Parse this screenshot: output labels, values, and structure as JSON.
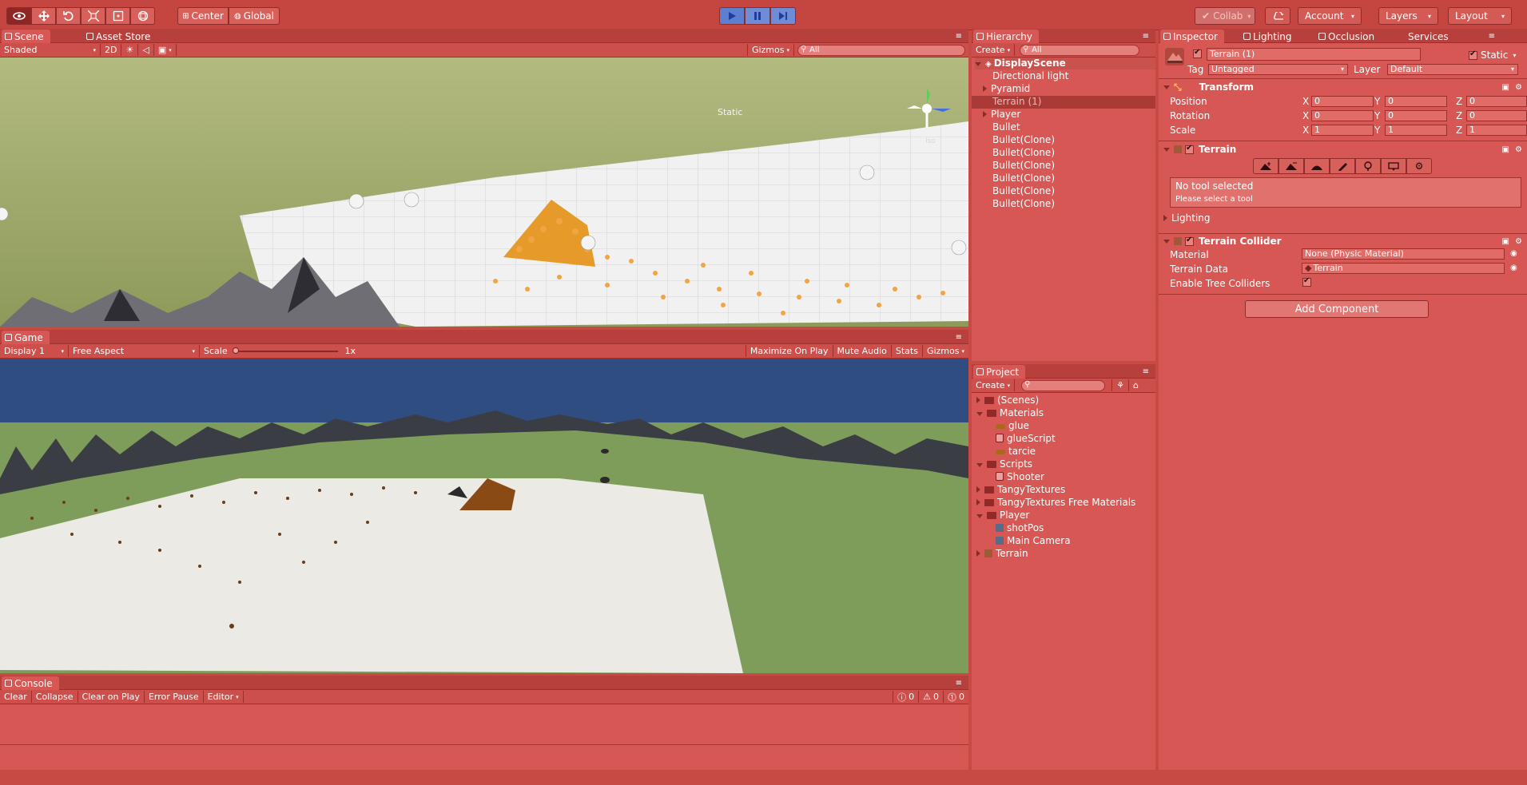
{
  "toolbar": {
    "pivot_label": "Center",
    "space_label": "Global",
    "collab_label": "Collab",
    "account_label": "Account",
    "layers_label": "Layers",
    "layout_label": "Layout",
    "tool_icons": [
      "eye-icon",
      "move-icon",
      "rotate-icon",
      "scale-icon",
      "rect-icon",
      "transform-icon"
    ]
  },
  "scene": {
    "tab_label": "Scene",
    "asset_store_label": "Asset Store",
    "shading_label": "Shaded",
    "mode_2d": "2D",
    "gizmos_label": "Gizmos",
    "search_placeholder": "All",
    "overlay_static": "Static",
    "overlay_iso": "Iso"
  },
  "game": {
    "tab_label": "Game",
    "display_label": "Display 1",
    "aspect_label": "Free Aspect",
    "scale_label": "Scale",
    "scale_value": "1x",
    "maximize_label": "Maximize On Play",
    "mute_label": "Mute Audio",
    "stats_label": "Stats",
    "gizmos_label": "Gizmos"
  },
  "console": {
    "tab_label": "Console",
    "buttons": [
      "Clear",
      "Collapse",
      "Clear on Play",
      "Error Pause",
      "Editor"
    ],
    "counts": {
      "info": "0",
      "warn": "0",
      "error": "0"
    }
  },
  "hierarchy": {
    "tab_label": "Hierarchy",
    "create_label": "Create",
    "search_placeholder": "All",
    "scene_name": "DisplayScene",
    "items": [
      {
        "label": "Directional light",
        "expandable": false,
        "selected": false
      },
      {
        "label": "Pyramid",
        "expandable": true,
        "selected": false
      },
      {
        "label": "Terrain (1)",
        "expandable": false,
        "selected": true
      },
      {
        "label": "Player",
        "expandable": true,
        "selected": false
      },
      {
        "label": "Bullet",
        "expandable": false,
        "selected": false
      },
      {
        "label": "Bullet(Clone)",
        "expandable": false,
        "selected": false
      },
      {
        "label": "Bullet(Clone)",
        "expandable": false,
        "selected": false
      },
      {
        "label": "Bullet(Clone)",
        "expandable": false,
        "selected": false
      },
      {
        "label": "Bullet(Clone)",
        "expandable": false,
        "selected": false
      },
      {
        "label": "Bullet(Clone)",
        "expandable": false,
        "selected": false
      },
      {
        "label": "Bullet(Clone)",
        "expandable": false,
        "selected": false
      }
    ]
  },
  "project": {
    "tab_label": "Project",
    "create_label": "Create",
    "items": [
      {
        "label": "(Scenes)",
        "icon": "folder-icon",
        "depth": 0,
        "arrow": "right"
      },
      {
        "label": "Materials",
        "icon": "folder-icon",
        "depth": 0,
        "arrow": "down"
      },
      {
        "label": "glue",
        "icon": "material-icon",
        "depth": 1,
        "arrow": ""
      },
      {
        "label": "glueScript",
        "icon": "script-icon",
        "depth": 1,
        "arrow": ""
      },
      {
        "label": "tarcie",
        "icon": "material-icon",
        "depth": 1,
        "arrow": ""
      },
      {
        "label": "Scripts",
        "icon": "folder-icon",
        "depth": 0,
        "arrow": "down"
      },
      {
        "label": "Shooter",
        "icon": "script-icon",
        "depth": 1,
        "arrow": ""
      },
      {
        "label": "TangyTextures",
        "icon": "folder-icon",
        "depth": 0,
        "arrow": "right"
      },
      {
        "label": "TangyTextures Free Materials",
        "icon": "folder-icon",
        "depth": 0,
        "arrow": "right"
      },
      {
        "label": "Player",
        "icon": "folder-icon",
        "depth": 0,
        "arrow": "down"
      },
      {
        "label": "shotPos",
        "icon": "cube-icon",
        "depth": 1,
        "arrow": ""
      },
      {
        "label": "Main Camera",
        "icon": "cube-icon",
        "depth": 1,
        "arrow": ""
      },
      {
        "label": "Terrain",
        "icon": "terrain-icon",
        "depth": 0,
        "arrow": "right"
      }
    ]
  },
  "inspector": {
    "tabs": [
      "Inspector",
      "Lighting",
      "Occlusion",
      "Services"
    ],
    "object_name": "Terrain (1)",
    "static_label": "Static",
    "tag_label": "Tag",
    "tag_value": "Untagged",
    "layer_label": "Layer",
    "layer_value": "Default",
    "transform": {
      "title": "Transform",
      "rows": [
        {
          "label": "Position",
          "x": "0",
          "y": "0",
          "z": "0"
        },
        {
          "label": "Rotation",
          "x": "0",
          "y": "0",
          "z": "0"
        },
        {
          "label": "Scale",
          "x": "1",
          "y": "1",
          "z": "1"
        }
      ]
    },
    "terrain": {
      "title": "Terrain",
      "no_tool": "No tool selected",
      "select_tool": "Please select a tool",
      "lighting_label": "Lighting"
    },
    "collider": {
      "title": "Terrain Collider",
      "material_label": "Material",
      "material_value": "None (Physic Material)",
      "data_label": "Terrain Data",
      "data_value": "Terrain",
      "trees_label": "Enable Tree Colliders"
    },
    "add_component": "Add Component"
  }
}
